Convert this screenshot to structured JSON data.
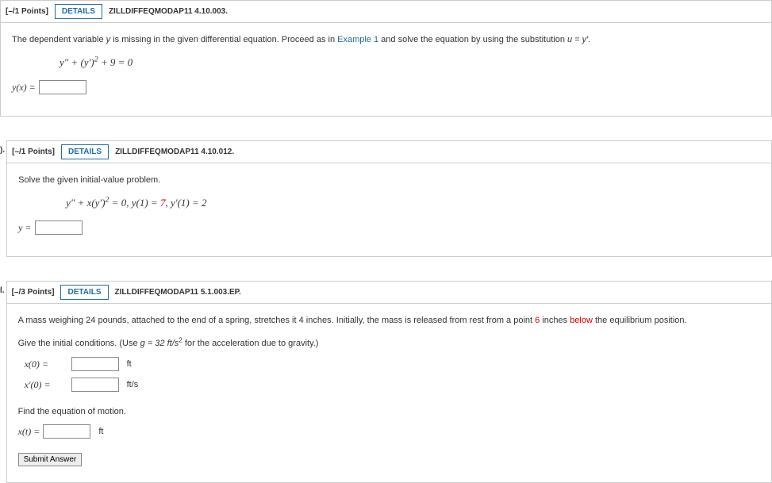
{
  "q1": {
    "points": "[–/1 Points]",
    "details": "DETAILS",
    "source": "ZILLDIFFEQMODAP11 4.10.003.",
    "prompt_a": "The dependent variable ",
    "prompt_b": " is missing in the given differential equation. Proceed as in ",
    "example": "Example 1",
    "prompt_c": " and solve the equation by using the substitution ",
    "sub_u": "u = y′",
    "period": ".",
    "eq_lhs": "y″ + (y′)",
    "eq_exp": "2",
    "eq_tail": " + 9 = 0",
    "ans_label": "y(x) = "
  },
  "q2": {
    "prefix": "). ",
    "points": "[–/1 Points]",
    "details": "DETAILS",
    "source": "ZILLDIFFEQMODAP11 4.10.012.",
    "prompt": "Solve the given initial-value problem.",
    "eq_a": "y″ + x(y′)",
    "eq_exp": "2",
    "eq_b": " = 0,  y(1) = ",
    "seven": "7",
    "eq_c": ",  y′(1) = 2",
    "ans_label": "y = "
  },
  "q3": {
    "prefix": "l. ",
    "points": "[–/3 Points]",
    "details": "DETAILS",
    "source": "ZILLDIFFEQMODAP11 5.1.003.EP.",
    "p1_a": "A mass weighing 24 pounds, attached to the end of a spring, stretches it 4 inches. Initially, the mass is released from rest from a point ",
    "six": "6",
    "p1_b": " inches ",
    "below": "below",
    "p1_c": " the equilibrium position.",
    "p2_a": "Give the initial conditions. (Use ",
    "g_eq": "g = 32 ft/s",
    "g_exp": "2",
    "p2_b": " for the acceleration due to gravity.)",
    "x0": "x(0)  = ",
    "unit_ft": "ft",
    "xp0": "x′(0)  = ",
    "unit_fts": "ft/s",
    "p3": "Find the equation of motion.",
    "xt": "x(t) = ",
    "submit": "Submit Answer"
  }
}
